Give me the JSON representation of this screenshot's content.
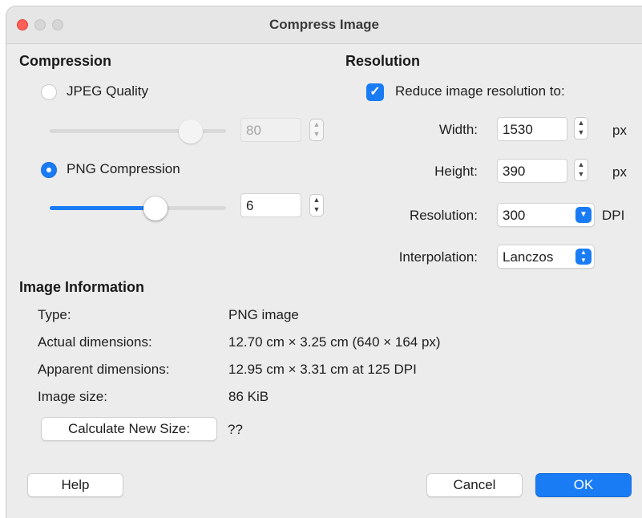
{
  "window": {
    "title": "Compress Image"
  },
  "compression": {
    "heading": "Compression",
    "jpeg_label": "JPEG Quality",
    "jpeg_selected": false,
    "jpeg_quality_value": "80",
    "jpeg_slider_level": 0.8,
    "png_label": "PNG Compression",
    "png_selected": true,
    "png_compression_value": "6",
    "png_slider_level": 0.6
  },
  "resolution": {
    "heading": "Resolution",
    "reduce_label": "Reduce image resolution to:",
    "reduce_checked": true,
    "width_label": "Width:",
    "width_value": "1530",
    "width_unit": "px",
    "height_label": "Height:",
    "height_value": "390",
    "height_unit": "px",
    "resolution_label": "Resolution:",
    "resolution_value": "300",
    "resolution_unit": "DPI",
    "interpolation_label": "Interpolation:",
    "interpolation_value": "Lanczos"
  },
  "image_info": {
    "heading": "Image Information",
    "type_label": "Type:",
    "type_value": "PNG image",
    "actual_label": "Actual dimensions:",
    "actual_value": "12.70 cm × 3.25 cm (640 × 164 px)",
    "apparent_label": "Apparent dimensions:",
    "apparent_value": "12.95 cm × 3.31 cm at 125 DPI",
    "size_label": "Image size:",
    "size_value": "86 KiB",
    "calculate_button": "Calculate New Size:",
    "calculated_value": "??"
  },
  "buttons": {
    "help": "Help",
    "cancel": "Cancel",
    "ok": "OK"
  },
  "colors": {
    "accent": "#1a7cf5",
    "close": "#ff5f57"
  }
}
